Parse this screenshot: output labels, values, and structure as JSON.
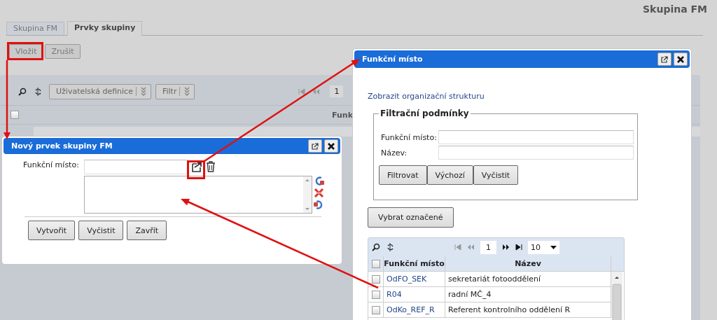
{
  "page": {
    "title": "Skupina FM"
  },
  "tabs": [
    {
      "label": "Skupina FM",
      "selected": false
    },
    {
      "label": "Prvky skupiny",
      "selected": true
    }
  ],
  "actions": [
    "Vložit",
    "Zrušit"
  ],
  "grid": {
    "toolbar_buttons": [
      "Uživatelská definice",
      "Filtr"
    ],
    "page": "1",
    "columns": [
      "Funk"
    ],
    "header_checked": false
  },
  "new_item_dialog": {
    "title": "Nový prvek skupiny FM",
    "field_label": "Funkční místo:",
    "buttons": [
      "Vytvořit",
      "Vyčistit",
      "Zavřít"
    ]
  },
  "lookup_dialog": {
    "title": "Funkční místo",
    "link": "Zobrazit organizační strukturu",
    "filter": {
      "legend": "Filtrační podmínky",
      "fields": [
        {
          "label": "Funkční místo:"
        },
        {
          "label": "Název:"
        }
      ],
      "buttons": [
        "Filtrovat",
        "Výchozí",
        "Vyčistit"
      ]
    },
    "select_button": "Vybrat označené",
    "grid": {
      "page": "1",
      "page_size": "10",
      "header_checked": false,
      "columns": [
        "Funkční místo",
        "Název"
      ],
      "rows": [
        {
          "code": "OdFO_SEK",
          "name": "sekretariát fotooddělení",
          "checked": false
        },
        {
          "code": "R04",
          "name": "radní MČ_4",
          "checked": false
        },
        {
          "code": "OdKo_REF_R",
          "name": "Referent kontrolního oddělení R",
          "checked": false
        }
      ]
    }
  }
}
